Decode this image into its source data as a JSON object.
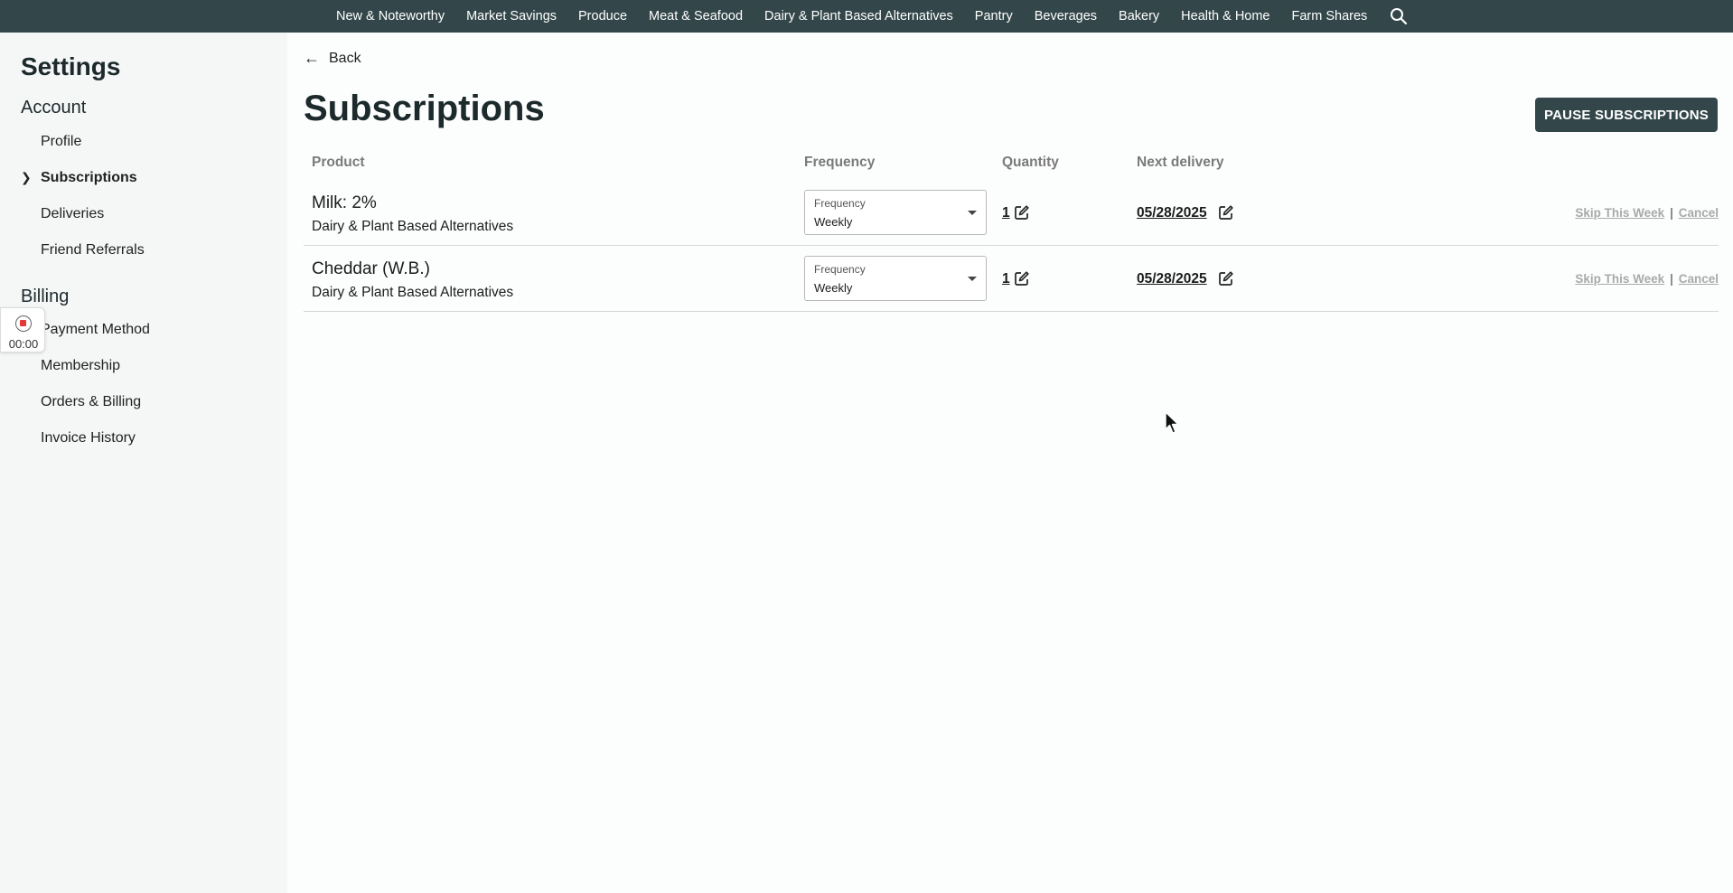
{
  "topnav": {
    "items": [
      "New & Noteworthy",
      "Market Savings",
      "Produce",
      "Meat & Seafood",
      "Dairy & Plant Based Alternatives",
      "Pantry",
      "Beverages",
      "Bakery",
      "Health & Home",
      "Farm Shares"
    ],
    "search_icon": "search-icon",
    "bg_color": "#33474a"
  },
  "sidebar": {
    "title": "Settings",
    "account": {
      "heading": "Account",
      "items": [
        "Profile",
        "Subscriptions",
        "Deliveries",
        "Friend Referrals"
      ],
      "active": "Subscriptions"
    },
    "billing": {
      "heading": "Billing",
      "items": [
        "Payment Method",
        "Membership",
        "Orders & Billing",
        "Invoice History"
      ]
    }
  },
  "recorder": {
    "time": "00:00",
    "icon": "record-stop-icon"
  },
  "main": {
    "back_label": "Back",
    "title": "Subscriptions",
    "pause_label": "PAUSE SUBSCRIPTIONS",
    "columns": {
      "product": "Product",
      "frequency": "Frequency",
      "quantity": "Quantity",
      "next_delivery": "Next delivery"
    },
    "rows": [
      {
        "name": "Milk: 2%",
        "category": "Dairy & Plant Based Alternatives",
        "frequency_label": "Frequency",
        "frequency_value": "Weekly",
        "quantity": "1",
        "next_delivery": "05/28/2025",
        "skip_label": "Skip This Week",
        "separator": "|",
        "cancel_label": "Cancel"
      },
      {
        "name": "Cheddar (W.B.)",
        "category": "Dairy & Plant Based Alternatives",
        "frequency_label": "Frequency",
        "frequency_value": "Weekly",
        "quantity": "1",
        "next_delivery": "05/28/2025",
        "skip_label": "Skip This Week",
        "separator": "|",
        "cancel_label": "Cancel"
      }
    ]
  }
}
